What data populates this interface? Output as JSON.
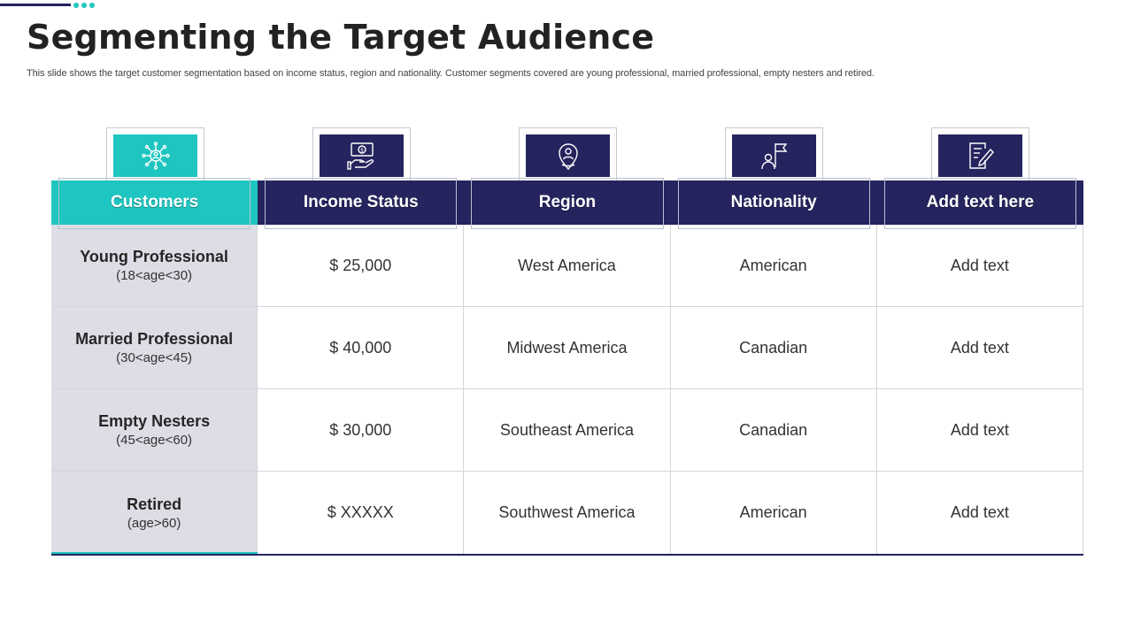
{
  "title": "Segmenting the Target Audience",
  "subtitle": "This slide shows the target customer segmentation based on income status, region and nationality. Customer segments covered are young professional, married professional, empty nesters and retired.",
  "colors": {
    "navy": "#25245e",
    "teal": "#1fc5c0",
    "first_column": "#dddde6"
  },
  "columns": [
    {
      "label": "Customers",
      "icon": "network-person-icon"
    },
    {
      "label": "Income Status",
      "icon": "money-hand-icon"
    },
    {
      "label": "Region",
      "icon": "location-person-icon"
    },
    {
      "label": "Nationality",
      "icon": "person-flag-icon"
    },
    {
      "label": "Add text here",
      "icon": "document-pen-icon"
    }
  ],
  "rows": [
    {
      "segment": "Young Professional",
      "age": "(18<age<30)",
      "income": "$ 25,000",
      "region": "West America",
      "nationality": "American",
      "extra": "Add text"
    },
    {
      "segment": "Married Professional",
      "age": "(30<age<45)",
      "income": "$ 40,000",
      "region": "Midwest America",
      "nationality": "Canadian",
      "extra": "Add text"
    },
    {
      "segment": "Empty Nesters",
      "age": "(45<age<60)",
      "income": "$ 30,000",
      "region": "Southeast America",
      "nationality": "Canadian",
      "extra": "Add text"
    },
    {
      "segment": "Retired",
      "age": "(age>60)",
      "income": "$ XXXXX",
      "region": "Southwest America",
      "nationality": "American",
      "extra": "Add text"
    }
  ]
}
